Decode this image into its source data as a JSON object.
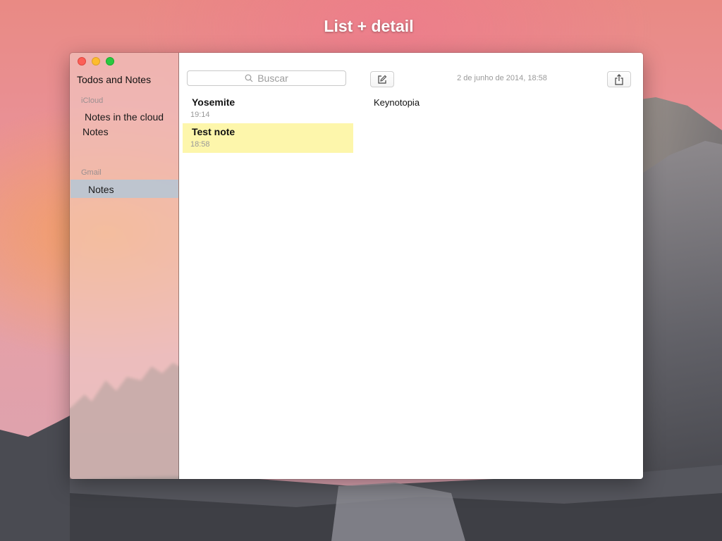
{
  "slide": {
    "title": "List + detail"
  },
  "window": {
    "sidebar": {
      "account_title": "Todos and Notes",
      "sections": [
        {
          "label": "iCloud",
          "items": [
            "Notes in the cloud",
            "Notes"
          ]
        },
        {
          "label": "Gmail",
          "items": [
            "Notes"
          ]
        }
      ]
    },
    "list": {
      "search_placeholder": "Buscar",
      "notes": [
        {
          "title": "Yosemite",
          "time": "19:14",
          "selected": false
        },
        {
          "title": "Test note",
          "time": "18:58",
          "selected": true
        }
      ]
    },
    "detail": {
      "date": "2 de junho de 2014, 18:58",
      "body": "Keynotopia"
    }
  },
  "colors": {
    "selected_note": "#fdf6ab",
    "selected_folder": "#bac6d2",
    "close": "#fc5f57",
    "minimize": "#fdbc2e",
    "zoom": "#29c940"
  },
  "icons": {
    "search": "search-icon",
    "compose": "compose-icon",
    "share": "share-icon"
  }
}
